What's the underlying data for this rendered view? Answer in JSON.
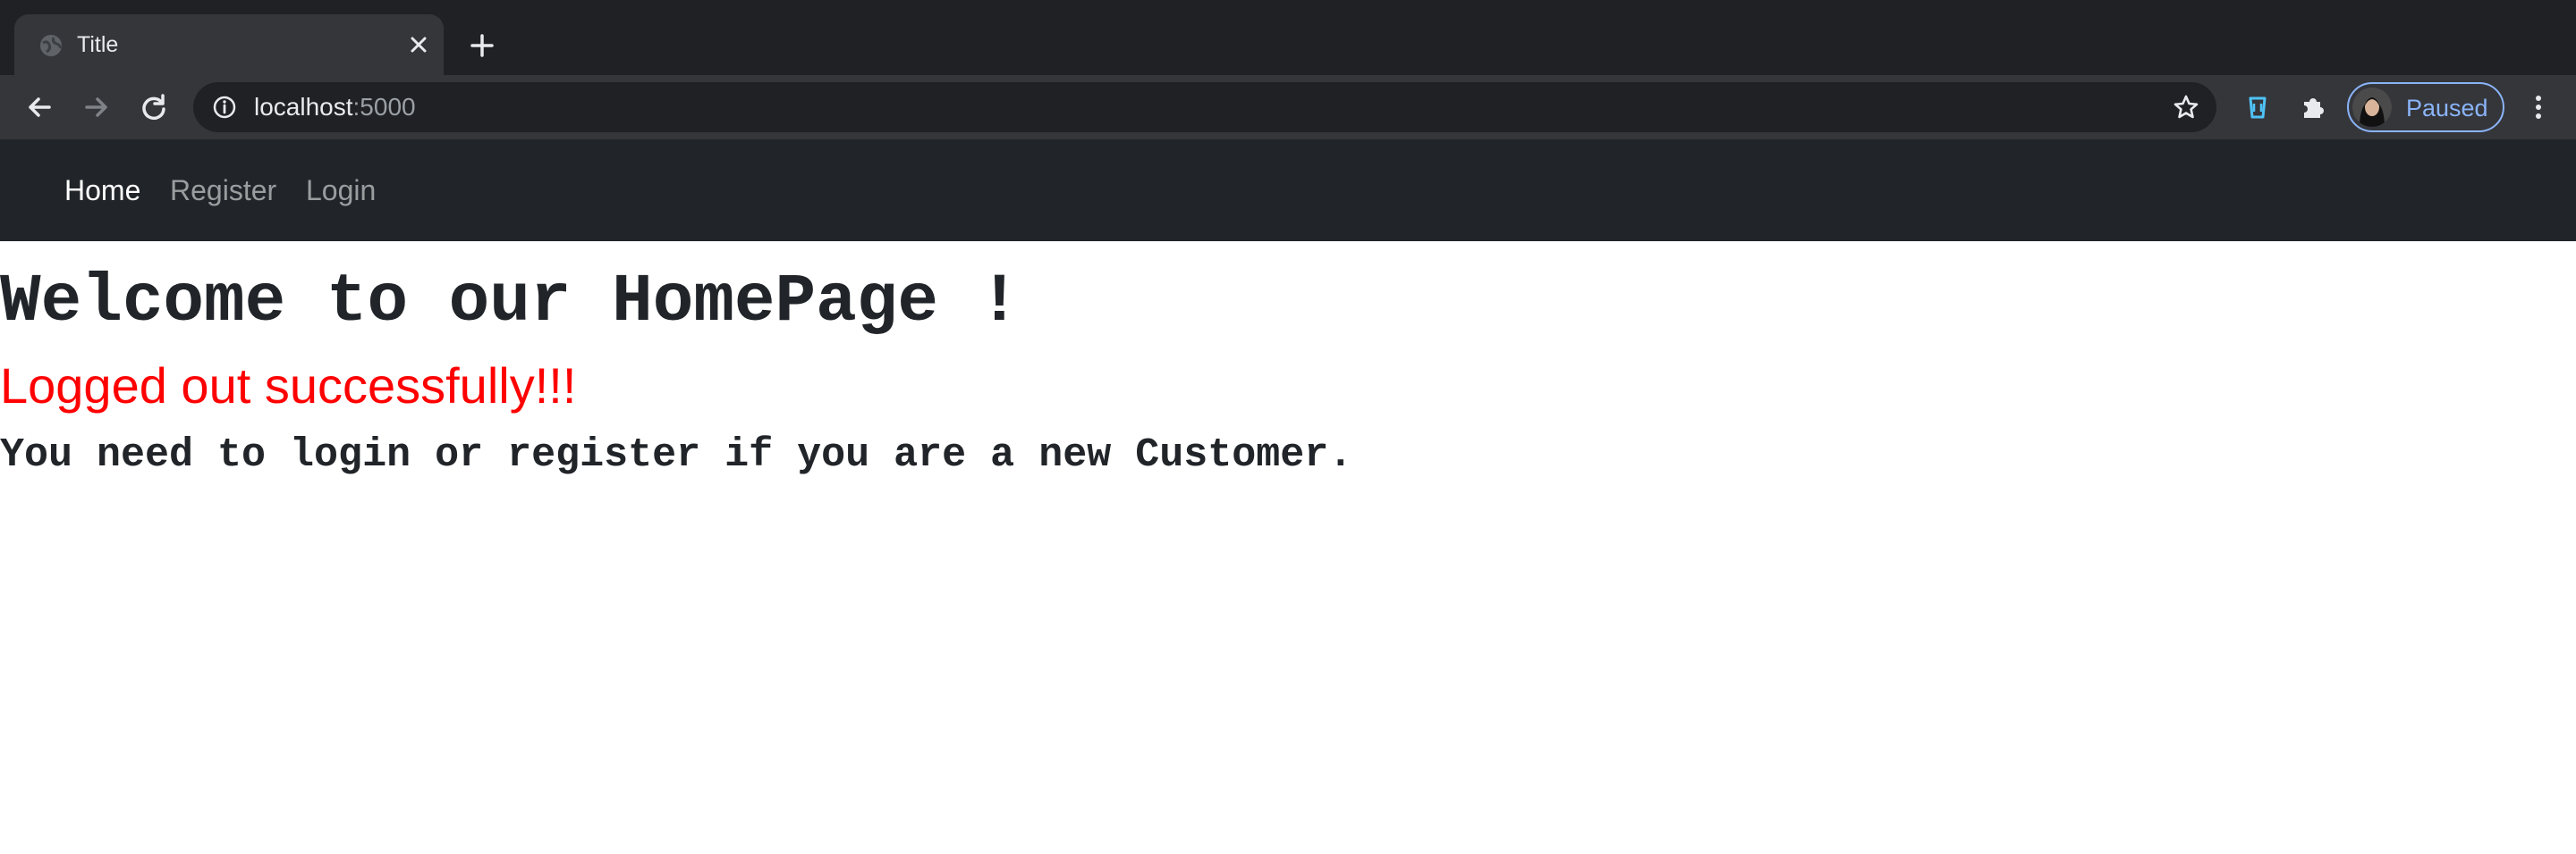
{
  "browser": {
    "tab_title": "Title",
    "url_host": "localhost",
    "url_port": ":5000",
    "profile_status": "Paused"
  },
  "icons": {
    "favicon": "globe-icon",
    "tab_close": "close-icon",
    "new_tab": "plus-icon",
    "back": "arrow-left-icon",
    "forward": "arrow-right-icon",
    "reload": "reload-icon",
    "site_info": "info-icon",
    "bookmark": "star-icon",
    "extension_1": "cup-icon",
    "extensions": "puzzle-icon",
    "menu": "kebab-menu-icon"
  },
  "navbar": {
    "links": [
      {
        "label": "Home",
        "active": true
      },
      {
        "label": "Register",
        "active": false
      },
      {
        "label": "Login",
        "active": false
      }
    ]
  },
  "page": {
    "heading": "Welcome to our HomePage !",
    "flash_message": "Logged out successfully!!!",
    "subtext": "You need to login or register if you are a new Customer."
  },
  "colors": {
    "chrome_dark": "#202124",
    "chrome_toolbar": "#35363a",
    "navbar_bg": "#212529",
    "flash_red": "#ff0000",
    "profile_accent": "#8ab4f8"
  }
}
